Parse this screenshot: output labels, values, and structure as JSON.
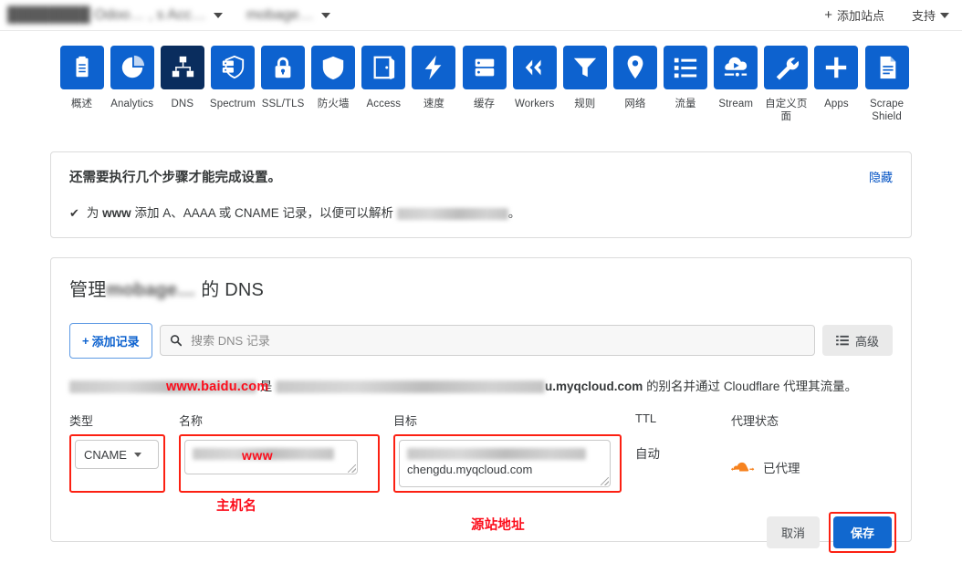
{
  "topbar": {
    "account_redacted": "████████ Odoo… , s Acc…",
    "zone_redacted": "mobage…",
    "add_site_label": "添加站点",
    "add_site_plus": "+",
    "support_label": "支持"
  },
  "nav": {
    "items": [
      {
        "label": "概述",
        "icon": "clipboard-icon",
        "active": false
      },
      {
        "label": "Analytics",
        "icon": "pie-chart-icon",
        "active": false
      },
      {
        "label": "DNS",
        "icon": "sitemap-icon",
        "active": true
      },
      {
        "label": "Spectrum",
        "icon": "spectrum-icon",
        "active": false
      },
      {
        "label": "SSL/TLS",
        "icon": "lock-icon",
        "active": false
      },
      {
        "label": "防火墙",
        "icon": "shield-icon",
        "active": false
      },
      {
        "label": "Access",
        "icon": "door-icon",
        "active": false
      },
      {
        "label": "速度",
        "icon": "bolt-icon",
        "active": false
      },
      {
        "label": "缓存",
        "icon": "database-icon",
        "active": false
      },
      {
        "label": "Workers",
        "icon": "code-brackets-icon",
        "active": false
      },
      {
        "label": "规则",
        "icon": "funnel-icon",
        "active": false
      },
      {
        "label": "网络",
        "icon": "map-pin-icon",
        "active": false
      },
      {
        "label": "流量",
        "icon": "list-icon",
        "active": false
      },
      {
        "label": "Stream",
        "icon": "video-cloud-icon",
        "active": false
      },
      {
        "label": "自定义页面",
        "icon": "wrench-icon",
        "active": false
      },
      {
        "label": "Apps",
        "icon": "plus-icon",
        "active": false
      },
      {
        "label": "Scrape Shield",
        "icon": "document-icon",
        "active": false
      }
    ]
  },
  "notice": {
    "title": "还需要执行几个步骤才能完成设置。",
    "hide_label": "隐藏",
    "check_glyph": "✔",
    "step_prefix": "为",
    "step_bold": "www",
    "step_middle": "添加 A、AAAA 或 CNAME 记录，以便可以解析",
    "step_domain_redacted": "████████████",
    "step_suffix": "。"
  },
  "dns": {
    "title_prefix": "管理",
    "title_zone_redacted": "mobage…",
    "title_suffix": "的 DNS",
    "add_record_label": "添加记录",
    "add_record_plus": "+",
    "search_placeholder": "搜索 DNS 记录",
    "search_value": "",
    "search_icon": "search-icon",
    "advanced_label": "高级",
    "advanced_icon": "list-icon",
    "description": {
      "redacted_head": "██████████████████",
      "middle": "是",
      "redacted_mid": "███████████████████████████",
      "target_bold": "u.myqcloud.com",
      "tail": "的别名并通过 Cloudflare 代理其流量。"
    }
  },
  "form": {
    "labels": {
      "type": "类型",
      "name": "名称",
      "target": "目标",
      "ttl": "TTL",
      "proxy": "代理状态"
    },
    "type_value": "CNAME",
    "name_redacted": "████████████",
    "target_line1_redacted": "██████████████████",
    "target_line2": "chengdu.myqcloud.com",
    "ttl_value": "自动",
    "proxy_value": "已代理",
    "proxy_icon": "cloudflare-cloud-icon"
  },
  "annotations": {
    "desc_domain": "www.baidu.com",
    "name_www": "www",
    "host_label": "主机名",
    "origin_label": "源站地址",
    "color": "#fc0d1b"
  },
  "actions": {
    "cancel_label": "取消",
    "save_label": "保存"
  },
  "colors": {
    "nav_blue": "#0d62cf",
    "nav_active": "#0a2d5e",
    "link_blue": "#0051c3",
    "save_blue": "#1168cf",
    "annotation_red": "#fc0d1b",
    "proxy_orange": "#f6821f"
  }
}
